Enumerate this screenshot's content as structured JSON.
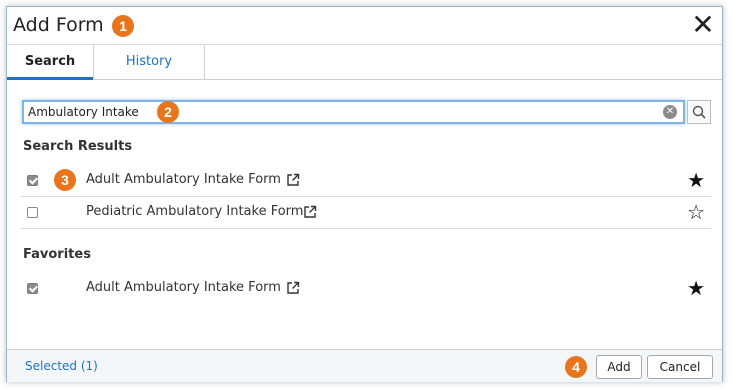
{
  "dialog": {
    "title": "Add Form",
    "close_glyph": "✕"
  },
  "badges": [
    "1",
    "2",
    "3",
    "4"
  ],
  "tabs": [
    {
      "label": "Search",
      "active": true
    },
    {
      "label": "History",
      "active": false
    }
  ],
  "search": {
    "value": "Ambulatory Intake",
    "clear_icon": "clear-icon",
    "search_icon": "magnifier-icon"
  },
  "results": {
    "heading": "Search Results",
    "items": [
      {
        "label": "Adult Ambulatory Intake Form",
        "checked": true,
        "favorite": true
      },
      {
        "label": "Pediatric Ambulatory Intake Form",
        "checked": false,
        "favorite": false
      }
    ]
  },
  "favorites": {
    "heading": "Favorites",
    "items": [
      {
        "label": "Adult Ambulatory Intake Form",
        "checked": true,
        "favorite": true
      }
    ]
  },
  "footer": {
    "selected_label": "Selected (1)",
    "add_label": "Add",
    "cancel_label": "Cancel"
  },
  "colors": {
    "accent": "#1a73c9",
    "badge": "#e8741c"
  }
}
